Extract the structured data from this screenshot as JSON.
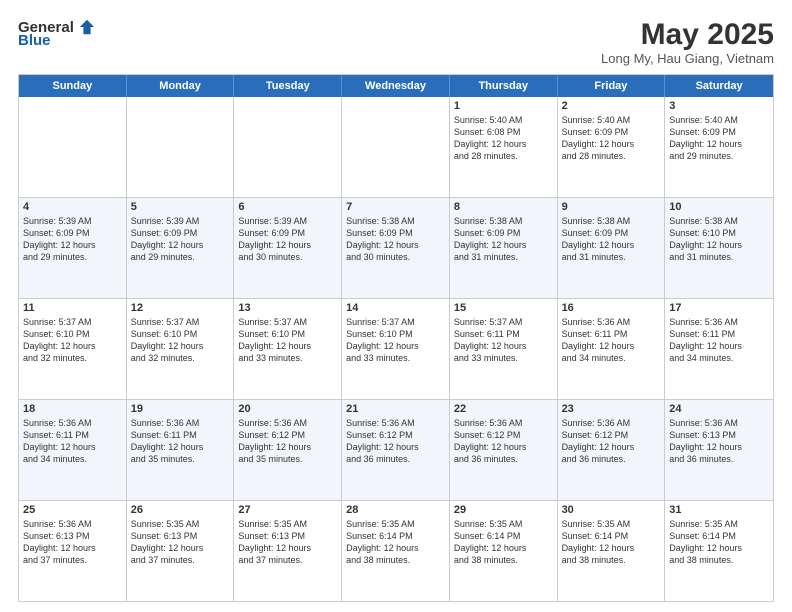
{
  "logo": {
    "general": "General",
    "blue": "Blue"
  },
  "title": "May 2025",
  "location": "Long My, Hau Giang, Vietnam",
  "days": [
    "Sunday",
    "Monday",
    "Tuesday",
    "Wednesday",
    "Thursday",
    "Friday",
    "Saturday"
  ],
  "weeks": [
    [
      {
        "day": "",
        "text": ""
      },
      {
        "day": "",
        "text": ""
      },
      {
        "day": "",
        "text": ""
      },
      {
        "day": "",
        "text": ""
      },
      {
        "day": "1",
        "text": "Sunrise: 5:40 AM\nSunset: 6:08 PM\nDaylight: 12 hours\nand 28 minutes."
      },
      {
        "day": "2",
        "text": "Sunrise: 5:40 AM\nSunset: 6:09 PM\nDaylight: 12 hours\nand 28 minutes."
      },
      {
        "day": "3",
        "text": "Sunrise: 5:40 AM\nSunset: 6:09 PM\nDaylight: 12 hours\nand 29 minutes."
      }
    ],
    [
      {
        "day": "4",
        "text": "Sunrise: 5:39 AM\nSunset: 6:09 PM\nDaylight: 12 hours\nand 29 minutes."
      },
      {
        "day": "5",
        "text": "Sunrise: 5:39 AM\nSunset: 6:09 PM\nDaylight: 12 hours\nand 29 minutes."
      },
      {
        "day": "6",
        "text": "Sunrise: 5:39 AM\nSunset: 6:09 PM\nDaylight: 12 hours\nand 30 minutes."
      },
      {
        "day": "7",
        "text": "Sunrise: 5:38 AM\nSunset: 6:09 PM\nDaylight: 12 hours\nand 30 minutes."
      },
      {
        "day": "8",
        "text": "Sunrise: 5:38 AM\nSunset: 6:09 PM\nDaylight: 12 hours\nand 31 minutes."
      },
      {
        "day": "9",
        "text": "Sunrise: 5:38 AM\nSunset: 6:09 PM\nDaylight: 12 hours\nand 31 minutes."
      },
      {
        "day": "10",
        "text": "Sunrise: 5:38 AM\nSunset: 6:10 PM\nDaylight: 12 hours\nand 31 minutes."
      }
    ],
    [
      {
        "day": "11",
        "text": "Sunrise: 5:37 AM\nSunset: 6:10 PM\nDaylight: 12 hours\nand 32 minutes."
      },
      {
        "day": "12",
        "text": "Sunrise: 5:37 AM\nSunset: 6:10 PM\nDaylight: 12 hours\nand 32 minutes."
      },
      {
        "day": "13",
        "text": "Sunrise: 5:37 AM\nSunset: 6:10 PM\nDaylight: 12 hours\nand 33 minutes."
      },
      {
        "day": "14",
        "text": "Sunrise: 5:37 AM\nSunset: 6:10 PM\nDaylight: 12 hours\nand 33 minutes."
      },
      {
        "day": "15",
        "text": "Sunrise: 5:37 AM\nSunset: 6:11 PM\nDaylight: 12 hours\nand 33 minutes."
      },
      {
        "day": "16",
        "text": "Sunrise: 5:36 AM\nSunset: 6:11 PM\nDaylight: 12 hours\nand 34 minutes."
      },
      {
        "day": "17",
        "text": "Sunrise: 5:36 AM\nSunset: 6:11 PM\nDaylight: 12 hours\nand 34 minutes."
      }
    ],
    [
      {
        "day": "18",
        "text": "Sunrise: 5:36 AM\nSunset: 6:11 PM\nDaylight: 12 hours\nand 34 minutes."
      },
      {
        "day": "19",
        "text": "Sunrise: 5:36 AM\nSunset: 6:11 PM\nDaylight: 12 hours\nand 35 minutes."
      },
      {
        "day": "20",
        "text": "Sunrise: 5:36 AM\nSunset: 6:12 PM\nDaylight: 12 hours\nand 35 minutes."
      },
      {
        "day": "21",
        "text": "Sunrise: 5:36 AM\nSunset: 6:12 PM\nDaylight: 12 hours\nand 36 minutes."
      },
      {
        "day": "22",
        "text": "Sunrise: 5:36 AM\nSunset: 6:12 PM\nDaylight: 12 hours\nand 36 minutes."
      },
      {
        "day": "23",
        "text": "Sunrise: 5:36 AM\nSunset: 6:12 PM\nDaylight: 12 hours\nand 36 minutes."
      },
      {
        "day": "24",
        "text": "Sunrise: 5:36 AM\nSunset: 6:13 PM\nDaylight: 12 hours\nand 36 minutes."
      }
    ],
    [
      {
        "day": "25",
        "text": "Sunrise: 5:36 AM\nSunset: 6:13 PM\nDaylight: 12 hours\nand 37 minutes."
      },
      {
        "day": "26",
        "text": "Sunrise: 5:35 AM\nSunset: 6:13 PM\nDaylight: 12 hours\nand 37 minutes."
      },
      {
        "day": "27",
        "text": "Sunrise: 5:35 AM\nSunset: 6:13 PM\nDaylight: 12 hours\nand 37 minutes."
      },
      {
        "day": "28",
        "text": "Sunrise: 5:35 AM\nSunset: 6:14 PM\nDaylight: 12 hours\nand 38 minutes."
      },
      {
        "day": "29",
        "text": "Sunrise: 5:35 AM\nSunset: 6:14 PM\nDaylight: 12 hours\nand 38 minutes."
      },
      {
        "day": "30",
        "text": "Sunrise: 5:35 AM\nSunset: 6:14 PM\nDaylight: 12 hours\nand 38 minutes."
      },
      {
        "day": "31",
        "text": "Sunrise: 5:35 AM\nSunset: 6:14 PM\nDaylight: 12 hours\nand 38 minutes."
      }
    ]
  ]
}
